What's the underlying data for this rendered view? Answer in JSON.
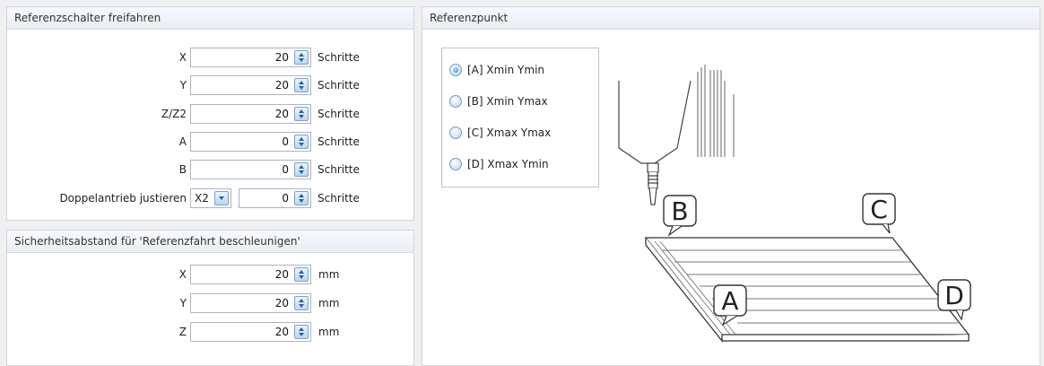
{
  "left_top": {
    "title": "Referenzschalter freifahren",
    "rows": [
      {
        "label": "X",
        "value": "20",
        "unit": "Schritte"
      },
      {
        "label": "Y",
        "value": "20",
        "unit": "Schritte"
      },
      {
        "label": "Z/Z2",
        "value": "20",
        "unit": "Schritte"
      },
      {
        "label": "A",
        "value": "0",
        "unit": "Schritte"
      },
      {
        "label": "B",
        "value": "0",
        "unit": "Schritte"
      }
    ],
    "doppel": {
      "label": "Doppelantrieb justieren",
      "combo_value": "X2",
      "value": "0",
      "unit": "Schritte"
    }
  },
  "left_bottom": {
    "title": "Sicherheitsabstand für 'Referenzfahrt beschleunigen'",
    "rows": [
      {
        "label": "X",
        "value": "20",
        "unit": "mm"
      },
      {
        "label": "Y",
        "value": "20",
        "unit": "mm"
      },
      {
        "label": "Z",
        "value": "20",
        "unit": "mm"
      }
    ]
  },
  "right": {
    "title": "Referenzpunkt",
    "options": [
      {
        "label": "[A]  Xmin Ymin",
        "selected": true
      },
      {
        "label": "[B] Xmin Ymax",
        "selected": false
      },
      {
        "label": "[C] Xmax Ymax",
        "selected": false
      },
      {
        "label": "[D] Xmax Ymin",
        "selected": false
      }
    ],
    "markers": {
      "a": "A",
      "b": "B",
      "c": "C",
      "d": "D"
    }
  },
  "icons": {
    "spin": "spin-updown-icon",
    "combo": "chevron-down-icon",
    "radio": "radio-icon"
  }
}
